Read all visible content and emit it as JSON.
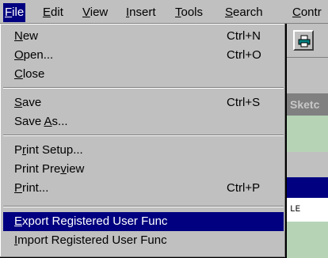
{
  "menubar": {
    "file": {
      "pre": "",
      "key": "F",
      "post": "ile"
    },
    "edit": {
      "pre": "",
      "key": "E",
      "post": "dit"
    },
    "view": {
      "pre": "",
      "key": "V",
      "post": "iew"
    },
    "insert": {
      "pre": "",
      "key": "I",
      "post": "nsert"
    },
    "tools": {
      "pre": "",
      "key": "T",
      "post": "ools"
    },
    "search": {
      "pre": "",
      "key": "S",
      "post": "earch"
    },
    "control": {
      "pre": "",
      "key": "C",
      "post": "ontr"
    }
  },
  "file_menu": {
    "new": {
      "pre": "",
      "key": "N",
      "post": "ew",
      "shortcut": "Ctrl+N"
    },
    "open": {
      "pre": "",
      "key": "O",
      "post": "pen...",
      "shortcut": "Ctrl+O"
    },
    "close": {
      "pre": "",
      "key": "C",
      "post": "lose"
    },
    "save": {
      "pre": "",
      "key": "S",
      "post": "ave",
      "shortcut": "Ctrl+S"
    },
    "save_as": {
      "pre": "Save ",
      "key": "A",
      "post": "s..."
    },
    "print_setup": {
      "pre": "P",
      "key": "r",
      "post": "int Setup..."
    },
    "print_preview": {
      "pre": "Print Pre",
      "key": "v",
      "post": "iew"
    },
    "print": {
      "pre": "",
      "key": "P",
      "post": "rint...",
      "shortcut": "Ctrl+P"
    },
    "export": {
      "pre": "",
      "key": "E",
      "post": "xport Registered User Func"
    },
    "import": {
      "pre": "",
      "key": "I",
      "post": "mport Registered User Func"
    }
  },
  "background": {
    "sketch_label": "Sketc",
    "text_fragment": "LE"
  },
  "colors": {
    "menu_bg": "#c0c0c0",
    "highlight": "#000080",
    "highlight_text": "#ffffff",
    "panel_green": "#b6d3b6"
  }
}
